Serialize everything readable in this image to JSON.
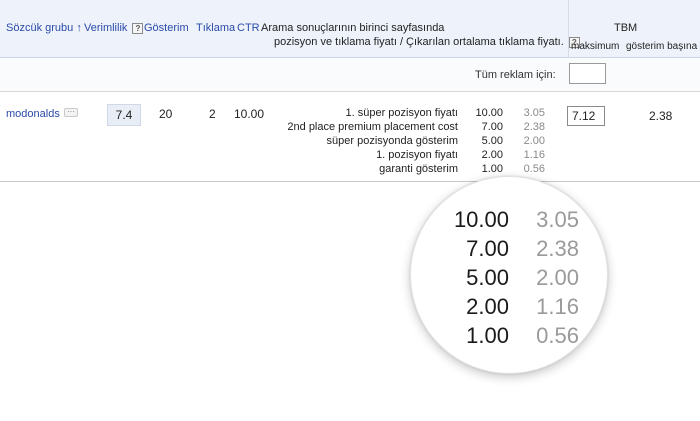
{
  "header": {
    "keyword_group_label": "Sözcük grubu",
    "sort_arrow": "↑",
    "quality_label": "Verimlilik",
    "help": "?",
    "impressions_label": "Gösterim",
    "clicks_label": "Tıklama",
    "ctr_label": "CTR",
    "position_line1": "Arama sonuçlarının birinci sayfasında",
    "position_line2": "pozisyon ve tıklama fiyatı / Çıkarılan ortalama tıklama fiyatı.",
    "cpc_label": "TBM",
    "max_label": "maksimum",
    "per_impression_label": "gösterim başına"
  },
  "all_ads": {
    "label": "Tüm reklam için:",
    "value": ""
  },
  "row": {
    "keyword": "modonalds",
    "more": "···",
    "quality_score": "7.4",
    "impressions": "20",
    "clicks": "2",
    "ctr": "10.00",
    "max_cpc": "7.12",
    "cost_per_impression": "2.38",
    "positions": [
      {
        "label": "1. süper pozisyon fiyatı",
        "bid": "10.00",
        "avg": "3.05"
      },
      {
        "label": "2nd place premium placement cost",
        "bid": "7.00",
        "avg": "2.38"
      },
      {
        "label": "süper pozisyonda gösterim",
        "bid": "5.00",
        "avg": "2.00"
      },
      {
        "label": "1. pozisyon fiyatı",
        "bid": "2.00",
        "avg": "1.16"
      },
      {
        "label": "garanti gösterim",
        "bid": "1.00",
        "avg": "0.56"
      }
    ]
  }
}
